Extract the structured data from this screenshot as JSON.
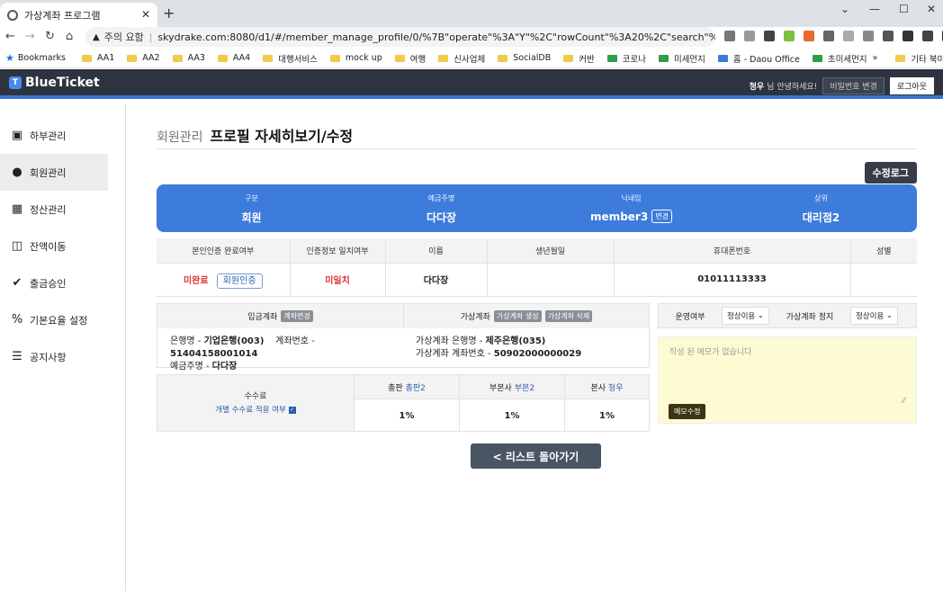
{
  "browser": {
    "tab_title": "가상계좌 프로그램",
    "security_label": "주의 요함",
    "url": "skydrake.com:8080/d1/#/member_manage_profile/0/%7B\"operate\"%3A\"Y\"%2C\"rowCount\"%3A20%2C\"search\"%3A%7...",
    "bookmarks": [
      "Bookmarks",
      "AA1",
      "AA2",
      "AA3",
      "AA4",
      "대행서비스",
      "mock up",
      "여행",
      "신사업체",
      "SocialDB",
      "커반",
      "코로나",
      "미세먼지",
      "홈 - Daou Office",
      "초미세먼지"
    ],
    "bookmarks_more": "»",
    "other_bookmarks": "기타 북마크"
  },
  "app": {
    "logo": "BlueTicket",
    "user_name": "청우",
    "greeting": "님 안녕하세요!",
    "change_pw": "비밀번호 변경",
    "logout": "로그아웃"
  },
  "sidebar": {
    "items": [
      {
        "label": "하부관리",
        "icon": "org-chart-icon"
      },
      {
        "label": "회원관리",
        "icon": "users-icon"
      },
      {
        "label": "정산관리",
        "icon": "calculator-icon"
      },
      {
        "label": "잔액이동",
        "icon": "transfer-icon"
      },
      {
        "label": "출금승인",
        "icon": "check-badge-icon"
      },
      {
        "label": "기본요율 설정",
        "icon": "percent-icon"
      },
      {
        "label": "공지사항",
        "icon": "list-icon"
      }
    ]
  },
  "main": {
    "crumb_parent": "회원관리",
    "page_title": "프로필 자세히보기/수정",
    "edit_log_btn": "수정로그",
    "summary": {
      "type_label": "구분",
      "type_value": "회원",
      "holder_label": "예금주명",
      "holder_value": "다다장",
      "nick_label": "닉네임",
      "nick_value": "member3",
      "nick_change": "변경",
      "parent_label": "상위",
      "parent_value": "대리점2"
    },
    "info_headers": [
      "본인인증 완료여부",
      "인증정보 일치여부",
      "이름",
      "생년월일",
      "휴대폰번호",
      "성별"
    ],
    "info_values": {
      "auth_status": "미완료",
      "auth_btn": "회원인증",
      "match_status": "미일치",
      "name": "다다장",
      "birth": "",
      "phone": "01011113333",
      "gender": ""
    },
    "deposit": {
      "header": "입금계좌",
      "change_btn": "계좌변경",
      "bank_label": "은행명 - ",
      "bank_value": "기업은행(003)",
      "acct_label": "계좌번호 - ",
      "acct_value": "51404158001014",
      "holder_label": "예금주명 - ",
      "holder_value": "다다장"
    },
    "virtual": {
      "header": "가상계좌",
      "create_btn": "가상계좌 생성",
      "delete_btn": "가상계좌 삭제",
      "bank_label": "가상계좌 은행명 - ",
      "bank_value": "제주은행(035)",
      "acct_label": "가상계좌 계좌번호 - ",
      "acct_value": "50902000000029"
    },
    "operation": {
      "status_label": "운영여부",
      "status_value": "정상이용",
      "stop_label": "가상계좌 정지",
      "stop_value": "정상이용"
    },
    "memo": {
      "placeholder": "작성 된 메모가 없습니다",
      "btn": "메모수정"
    },
    "fee": {
      "title": "수수료",
      "sub": "개별 수수료 적용 여부",
      "cols": [
        {
          "label": "총판",
          "name": "총판2",
          "value": "1%"
        },
        {
          "label": "부본사",
          "name": "부본2",
          "value": "1%"
        },
        {
          "label": "본사",
          "name": "청우",
          "value": "1%"
        }
      ]
    },
    "back_btn": "< 리스트 돌아가기"
  }
}
